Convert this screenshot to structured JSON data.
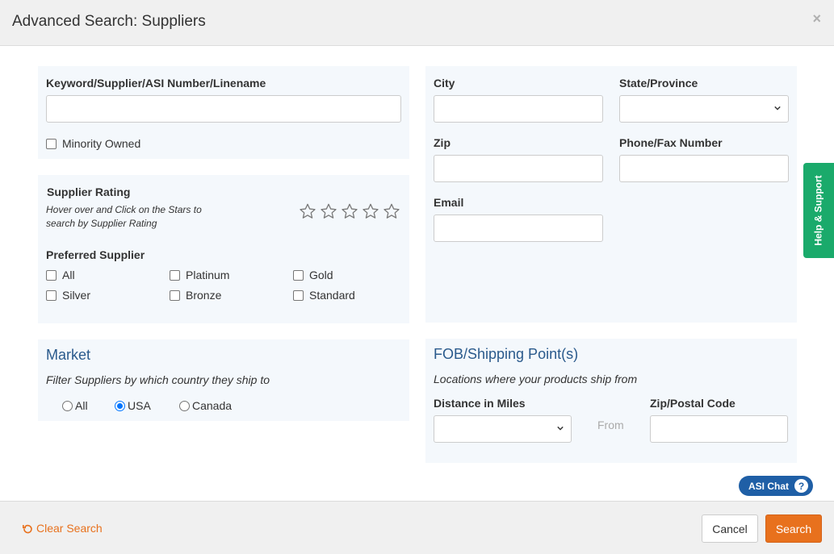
{
  "dialog": {
    "title": "Advanced Search: Suppliers",
    "close_glyph": "×"
  },
  "keyword": {
    "label": "Keyword/Supplier/ASI Number/Linename",
    "value": "",
    "minority_label": "Minority Owned"
  },
  "rating": {
    "label": "Supplier Rating",
    "hint_line1": "Hover over and Click on the Stars to",
    "hint_line2": "search by Supplier Rating",
    "stars": 5
  },
  "preferred": {
    "label": "Preferred Supplier",
    "options": [
      "All",
      "Platinum",
      "Gold",
      "Silver",
      "Bronze",
      "Standard"
    ]
  },
  "location": {
    "city_label": "City",
    "state_label": "State/Province",
    "zip_label": "Zip",
    "phone_label": "Phone/Fax Number",
    "email_label": "Email"
  },
  "market": {
    "title": "Market",
    "hint": "Filter Suppliers by which country they ship to",
    "options": [
      "All",
      "USA",
      "Canada"
    ],
    "selected": "USA"
  },
  "fob": {
    "title": "FOB/Shipping Point(s)",
    "hint": "Locations where your products ship from",
    "distance_label": "Distance in Miles",
    "from_label": "From",
    "zip_label": "Zip/Postal Code"
  },
  "help_tab": {
    "label": "Help & Support",
    "color": "#1aaa6b"
  },
  "chat": {
    "label": "ASI Chat",
    "icon": "?"
  },
  "footer": {
    "clear_label": "Clear Search",
    "cancel_label": "Cancel",
    "search_label": "Search"
  },
  "colors": {
    "accent": "#e8711d",
    "panel_bg": "#f4f8fc",
    "section_title": "#2a5a8c",
    "chat_bg": "#1f5fa6"
  }
}
